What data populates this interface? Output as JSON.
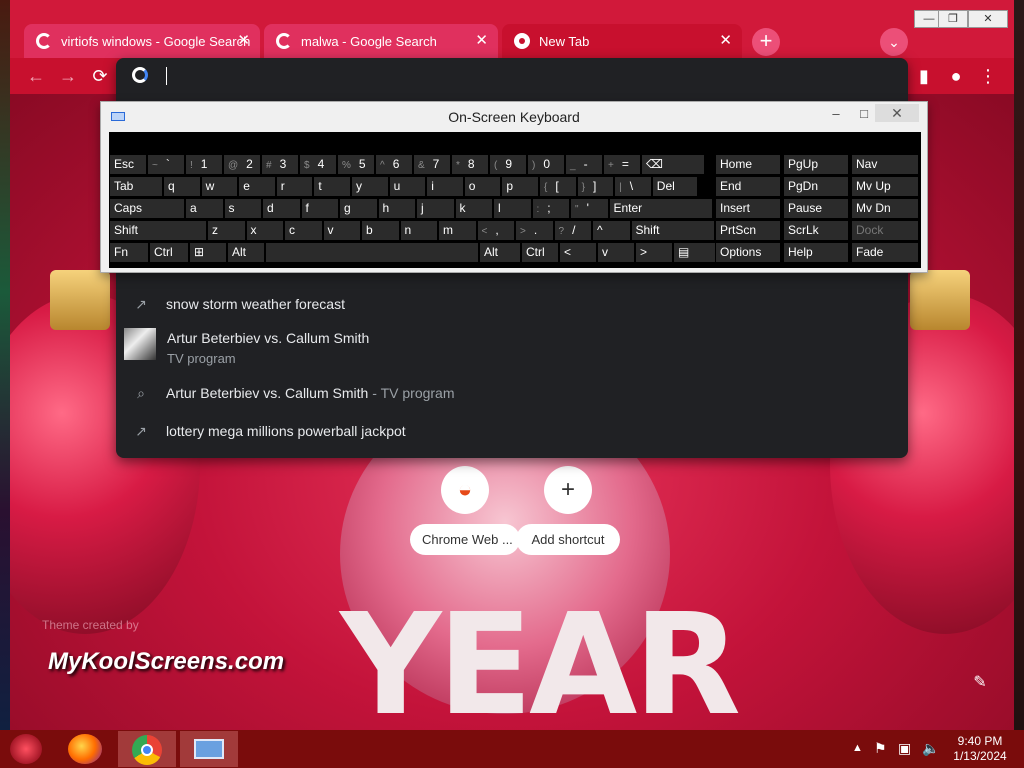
{
  "tabs": [
    {
      "title": "virtiofs windows - Google Search",
      "close": "✕",
      "active": false
    },
    {
      "title": "malwa - Google Search",
      "close": "✕",
      "active": false
    },
    {
      "title": "New Tab",
      "close": "✕",
      "active": true
    }
  ],
  "tabstrip": {
    "new_tab": "+",
    "tab_search": "⌄"
  },
  "window_controls": {
    "minimize": "—",
    "restore": "❐",
    "close": "✕"
  },
  "toolbar": {
    "back": "←",
    "forward": "→",
    "reload": "⟳",
    "side_panel": "▮",
    "profile": "●",
    "menu": "⋮"
  },
  "omnibox": {
    "value": "",
    "suggestions": [
      {
        "icon": "trending-icon",
        "glyph": "↗",
        "text": "snow storm weather forecast",
        "sub": ""
      },
      {
        "icon": "thumbnail",
        "glyph": "",
        "text": "Artur Beterbiev vs. Callum Smith",
        "sub": "TV program"
      },
      {
        "icon": "search-icon",
        "glyph": "⌕",
        "text": "Artur Beterbiev vs. Callum Smith",
        "sub": "- TV program"
      },
      {
        "icon": "trending-icon",
        "glyph": "↗",
        "text": "lottery mega millions powerball jackpot",
        "sub": ""
      }
    ]
  },
  "osk": {
    "title": "On-Screen Keyboard",
    "minimize": "–",
    "maximize": "□",
    "close": "✕",
    "row1": [
      {
        "main": "Esc",
        "shift": ""
      },
      {
        "main": "`",
        "shift": "~"
      },
      {
        "main": "1",
        "shift": "!"
      },
      {
        "main": "2",
        "shift": "@"
      },
      {
        "main": "3",
        "shift": "#"
      },
      {
        "main": "4",
        "shift": "$"
      },
      {
        "main": "5",
        "shift": "%"
      },
      {
        "main": "6",
        "shift": "^"
      },
      {
        "main": "7",
        "shift": "&"
      },
      {
        "main": "8",
        "shift": "*"
      },
      {
        "main": "9",
        "shift": "("
      },
      {
        "main": "0",
        "shift": ")"
      },
      {
        "main": "-",
        "shift": "_"
      },
      {
        "main": "=",
        "shift": "+"
      },
      {
        "main": "⌫",
        "shift": ""
      }
    ],
    "row2": [
      "Tab",
      "q",
      "w",
      "e",
      "r",
      "t",
      "y",
      "u",
      "i",
      "o",
      "p",
      "[",
      "]",
      "\\",
      "Del"
    ],
    "row2_shift": [
      "",
      "",
      "",
      "",
      "",
      "",
      "",
      "",
      "",
      "",
      "",
      "{",
      "}",
      "|",
      ""
    ],
    "row3": [
      "Caps",
      "a",
      "s",
      "d",
      "f",
      "g",
      "h",
      "j",
      "k",
      "l",
      ";",
      "'",
      "Enter"
    ],
    "row3_shift": [
      "",
      "",
      "",
      "",
      "",
      "",
      "",
      "",
      "",
      "",
      ":",
      "\"",
      ""
    ],
    "row4": [
      "Shift",
      "z",
      "x",
      "c",
      "v",
      "b",
      "n",
      "m",
      ",",
      ".",
      "/",
      "^",
      "Shift"
    ],
    "row4_shift": [
      "",
      "",
      "",
      "",
      "",
      "",
      "",
      "",
      "<",
      ">",
      "?",
      "",
      ""
    ],
    "row5": [
      "Fn",
      "Ctrl",
      "⊞",
      "Alt",
      "",
      "Alt",
      "Ctrl",
      "<",
      "v",
      ">",
      "▤"
    ],
    "nav": [
      [
        "Home",
        "PgUp",
        "Nav"
      ],
      [
        "End",
        "PgDn",
        "Mv Up"
      ],
      [
        "Insert",
        "Pause",
        "Mv Dn"
      ],
      [
        "PrtScn",
        "ScrLk",
        "Dock"
      ],
      [
        "Options",
        "Help",
        "Fade"
      ]
    ]
  },
  "shortcuts": [
    {
      "label": "Chrome Web ...",
      "glyph": "◒"
    },
    {
      "label": "Add shortcut",
      "glyph": "+"
    }
  ],
  "ntp": {
    "theme_credit": "Theme created by",
    "watermark": "MyKoolScreens.com",
    "big_text": "YEAR",
    "customize": "✎"
  },
  "taskbar": {
    "time": "9:40 PM",
    "date": "1/13/2024"
  }
}
